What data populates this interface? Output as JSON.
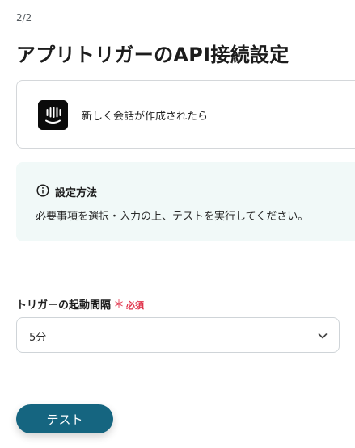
{
  "header": {
    "step": "2/2",
    "title": "アプリトリガーのAPI接続設定"
  },
  "app_card": {
    "icon": "intercom-logo-icon",
    "label": "新しく会話が作成されたら"
  },
  "info": {
    "icon": "info-circle-icon",
    "title": "設定方法",
    "body": "必要事項を選択・入力の上、テストを実行してください。"
  },
  "trigger_interval": {
    "label": "トリガーの起動間隔",
    "required_mark": "＊",
    "required_text": "必須",
    "selected_value": "5分",
    "icon": "chevron-down-icon"
  },
  "actions": {
    "test_label": "テスト"
  },
  "colors": {
    "primary_button": "#156580",
    "info_background": "#f1f9f8",
    "required": "#e0334b",
    "card_border": "#d4d7da"
  }
}
